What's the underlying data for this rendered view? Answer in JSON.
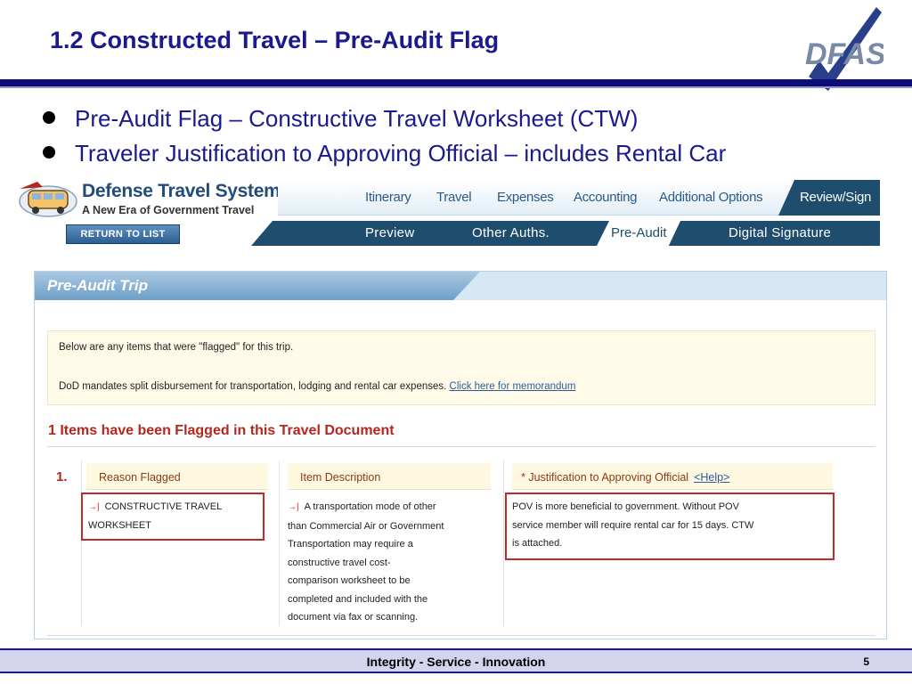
{
  "slide": {
    "title": "1.2 Constructed Travel – Pre-Audit Flag",
    "logo_text": "DFAS",
    "bullets": [
      "Pre-Audit Flag – Constructive Travel Worksheet (CTW)",
      "Traveler Justification to Approving Official – includes Rental Car"
    ],
    "footer_motto": "Integrity - Service - Innovation",
    "page_number": "5"
  },
  "dts": {
    "name": "Defense Travel System",
    "tagline": "A New Era of Government Travel",
    "return_button": "RETURN TO LIST",
    "nav_top": [
      "Itinerary",
      "Travel",
      "Expenses",
      "Accounting",
      "Additional Options"
    ],
    "nav_top_active": "Review/Sign",
    "nav_bottom": [
      "Preview",
      "Other Auths.",
      "Digital Signature"
    ],
    "nav_bottom_active": "Pre-Audit"
  },
  "panel": {
    "title": "Pre-Audit Trip",
    "info_line1": "Below are any items that were \"flagged\" for this trip.",
    "info_line2": "DoD mandates split disbursement for transportation, lodging and rental car expenses.",
    "info_link": "Click here for memorandum",
    "flag_heading": "1 Items have been Flagged in this Travel Document",
    "row_number": "1.",
    "col_reason": "Reason Flagged",
    "col_item": "Item Description",
    "col_just_req": "*",
    "col_just": "Justification to Approving Official",
    "help_link": "<Help>",
    "reason_line1": "CONSTRUCTIVE TRAVEL",
    "reason_line2": "WORKSHEET",
    "item_lines": [
      "A transportation mode of other",
      "than Commercial Air or Government",
      "Transportation may require a",
      "constructive travel cost-",
      "comparison worksheet to be",
      "completed and included with the",
      "document via fax or scanning."
    ],
    "just_lines": [
      "POV is more beneficial to government. Without POV",
      "service member will require rental car for 15 days. CTW",
      "is attached."
    ]
  },
  "colors": {
    "title_blue": "#1a1a8c",
    "nav_dark": "#1f4d6d",
    "flag_red": "#b5261e"
  }
}
